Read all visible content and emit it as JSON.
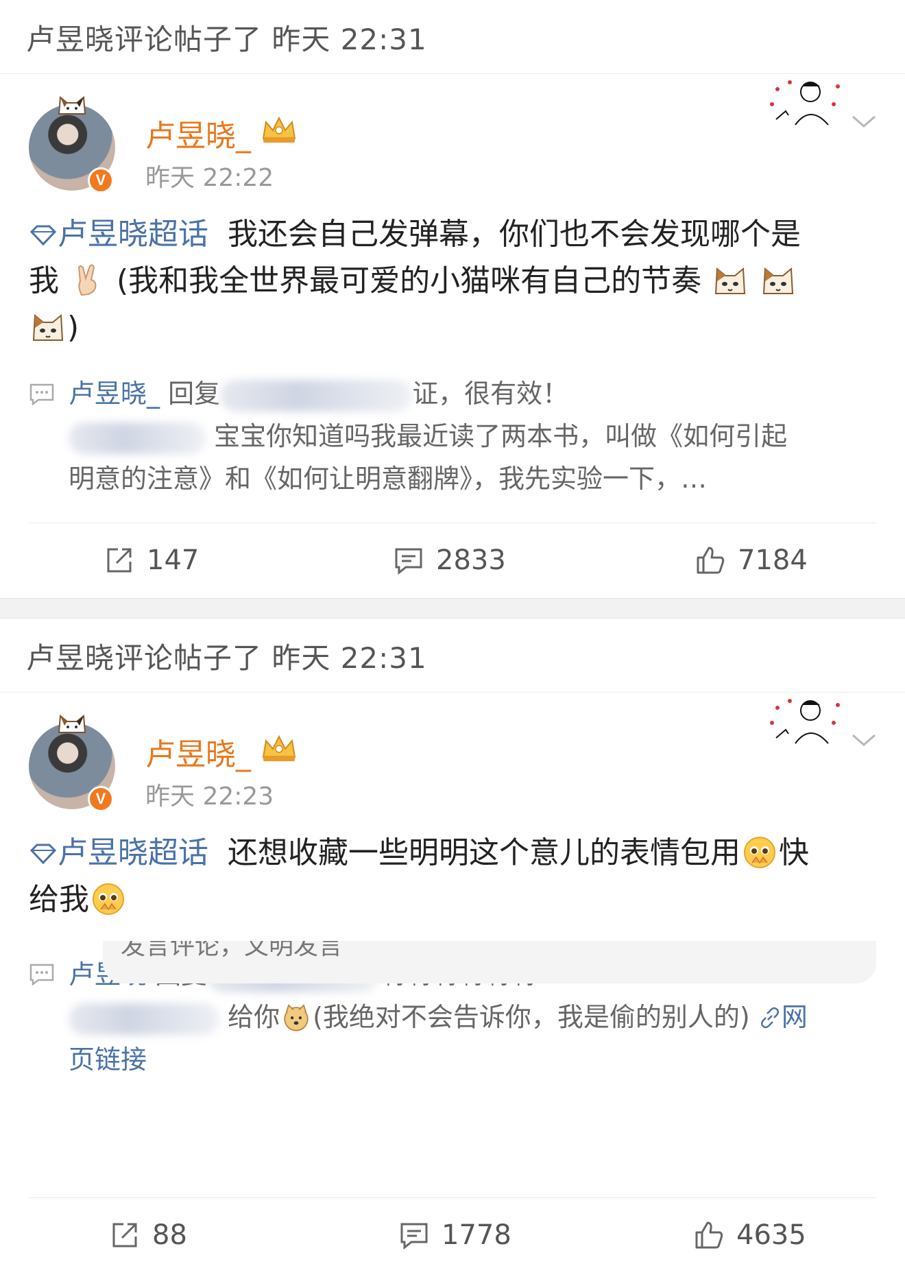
{
  "posts": [
    {
      "header": "卢昱晓评论帖子了 昨天 22:31",
      "username": "卢昱晓_",
      "time": "昨天 22:22",
      "topic": "卢昱晓超话",
      "text_line1": "我还会自己发弹幕，你们也不会发现哪个是",
      "text_line2a": "我",
      "text_line2b": "(我和我全世界最可爱的小猫咪有自己的节奏",
      "text_line3": ")",
      "reply_user": "卢昱晓_",
      "reply_mid": "回复",
      "reply_tail": "证，很有效！",
      "reply_line2": "宝宝你知道吗我最近读了两本书，叫做《如何引起",
      "reply_line3": "明意的注意》和《如何让明意翻牌》，我先实验一下，…",
      "reposts": "147",
      "comments": "2833",
      "likes": "7184"
    },
    {
      "header": "卢昱晓评论帖子了 昨天 22:31",
      "username": "卢昱晓_",
      "time": "昨天 22:23",
      "topic": "卢昱晓超话",
      "text_line1": "还想收藏一些明明这个意儿的表情包用",
      "text_line1b": "快",
      "text_line2": "给我",
      "reply_user": "卢昱晓",
      "reply_mid": "回复",
      "reply_tail": "啊啊啊啊啊啊",
      "reply_line2a": "给你",
      "reply_line2b": "(我绝对不会告诉你，我是偷的别人的)",
      "reply_link": "网",
      "reply_line3": "页链接",
      "input_hint": "发言评论，文明发言",
      "reposts": "88",
      "comments": "1778",
      "likes": "4635"
    }
  ],
  "icons": [
    "topic-diamond-icon",
    "verified-badge-icon",
    "crown-icon",
    "chevron-down-icon",
    "comment-icon",
    "repost-icon",
    "like-icon",
    "cat-emoji-icon",
    "victory-hand-icon",
    "pleading-face-icon",
    "doge-icon",
    "link-icon"
  ],
  "colors": {
    "username": "#e8781c",
    "topic": "#4a72a7",
    "meta": "#999999",
    "badge": "#f07a1d"
  }
}
